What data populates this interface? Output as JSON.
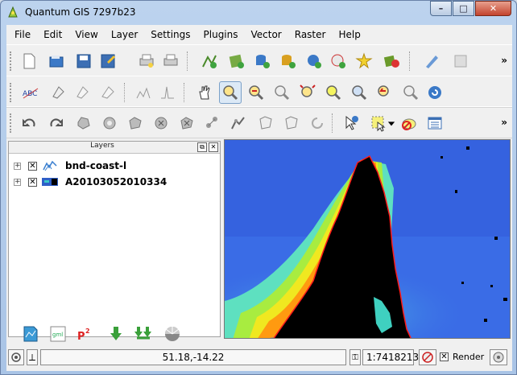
{
  "window": {
    "title": "Quantum GIS 7297b23",
    "minimize": "–",
    "maximize": "□",
    "close": "✕"
  },
  "menu": [
    "File",
    "Edit",
    "View",
    "Layer",
    "Settings",
    "Plugins",
    "Vector",
    "Raster",
    "Help"
  ],
  "toolbar_more": "»",
  "layers": {
    "title": "Layers",
    "float_btn": "⧉",
    "close_btn": "✕",
    "items": [
      {
        "name": "bnd-coast-l",
        "checked": "✕",
        "expander": "+",
        "icon": "line-vector-icon"
      },
      {
        "name": "A20103052010334",
        "checked": "✕",
        "expander": "+",
        "icon": "raster-icon"
      }
    ]
  },
  "status": {
    "coordinate_toggle": "⟂",
    "coordinates": "51.18,-14.22",
    "scale_label": "1:7418213",
    "render_check": "✕",
    "render_label": "Render"
  },
  "colors": {
    "map_ocean": "#3c6ee8",
    "land": "#000000",
    "coast": "#ff1a1a",
    "accent_active": "#dce9f6"
  }
}
